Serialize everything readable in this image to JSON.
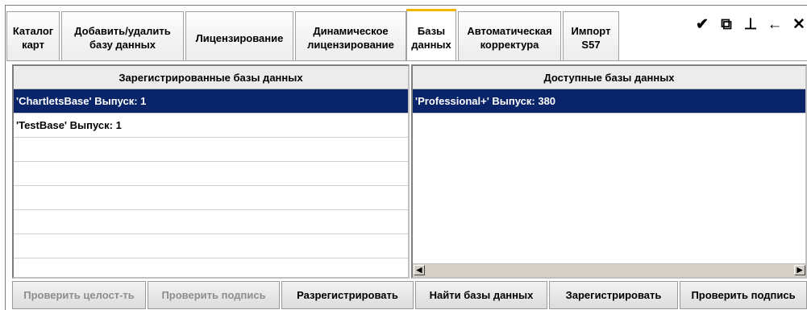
{
  "tabs": [
    {
      "label": "Каталог\nкарт",
      "active": false
    },
    {
      "label": "Добавить/удалить\nбазу данных",
      "active": false
    },
    {
      "label": "Лицензирование",
      "active": false
    },
    {
      "label": "Динамическое\nлицензирование",
      "active": false
    },
    {
      "label": "Базы\nданных",
      "active": true
    },
    {
      "label": "Автоматическая\nкорректура",
      "active": false
    },
    {
      "label": "Импорт\nS57",
      "active": false
    }
  ],
  "toolbar": {
    "broom_icon": "✔",
    "window_icon": "⧉",
    "pin_icon": "⊥",
    "back_icon": "←",
    "close_icon": "✕"
  },
  "left_panel": {
    "header": "Зарегистрированные базы данных",
    "rows": [
      "'ChartletsBase' Выпуск: 1",
      "'TestBase' Выпуск: 1",
      "",
      "",
      "",
      "",
      ""
    ]
  },
  "right_panel": {
    "header": "Доступные базы данных",
    "rows": [
      "'Professional+' Выпуск: 380"
    ]
  },
  "buttons": {
    "check_integrity": "Проверить целост-ть",
    "check_signature_left": "Проверить подпись",
    "unregister": "Разрегистрировать",
    "find_databases": "Найти базы данных",
    "register": "Зарегистрировать",
    "check_signature_right": "Проверить подпись"
  },
  "colors": {
    "selection": "#0a246a",
    "active_tab_accent": "#f5b400",
    "disabled_text": "#8d8d8d"
  }
}
